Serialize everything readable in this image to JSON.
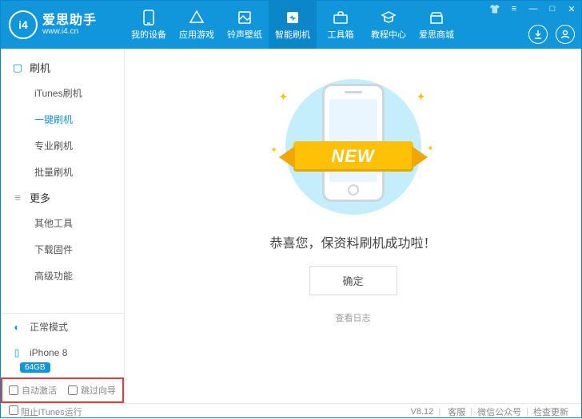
{
  "brand": {
    "logo_text": "i4",
    "name": "爱思助手",
    "url": "www.i4.cn"
  },
  "nav": {
    "items": [
      {
        "label": "我的设备"
      },
      {
        "label": "应用游戏"
      },
      {
        "label": "铃声壁纸"
      },
      {
        "label": "智能刷机"
      },
      {
        "label": "工具箱"
      },
      {
        "label": "教程中心"
      },
      {
        "label": "爱思商城"
      }
    ]
  },
  "sidebar": {
    "group_flash": "刷机",
    "flash_items": [
      "iTunes刷机",
      "一键刷机",
      "专业刷机",
      "批量刷机"
    ],
    "group_more": "更多",
    "more_items": [
      "其他工具",
      "下载固件",
      "高级功能"
    ],
    "mode_label": "正常模式",
    "device_name": "iPhone 8",
    "storage_badge": "64GB",
    "opt_auto_activate": "自动激活",
    "opt_skip_guide": "跳过向导"
  },
  "content": {
    "ribbon_text": "NEW",
    "success_message": "恭喜您，保资料刷机成功啦！",
    "confirm_label": "确定",
    "log_link": "查看日志"
  },
  "statusbar": {
    "block_itunes": "阻止iTunes运行",
    "version": "V8.12",
    "links": [
      "客服",
      "微信公众号",
      "检查更新"
    ]
  }
}
